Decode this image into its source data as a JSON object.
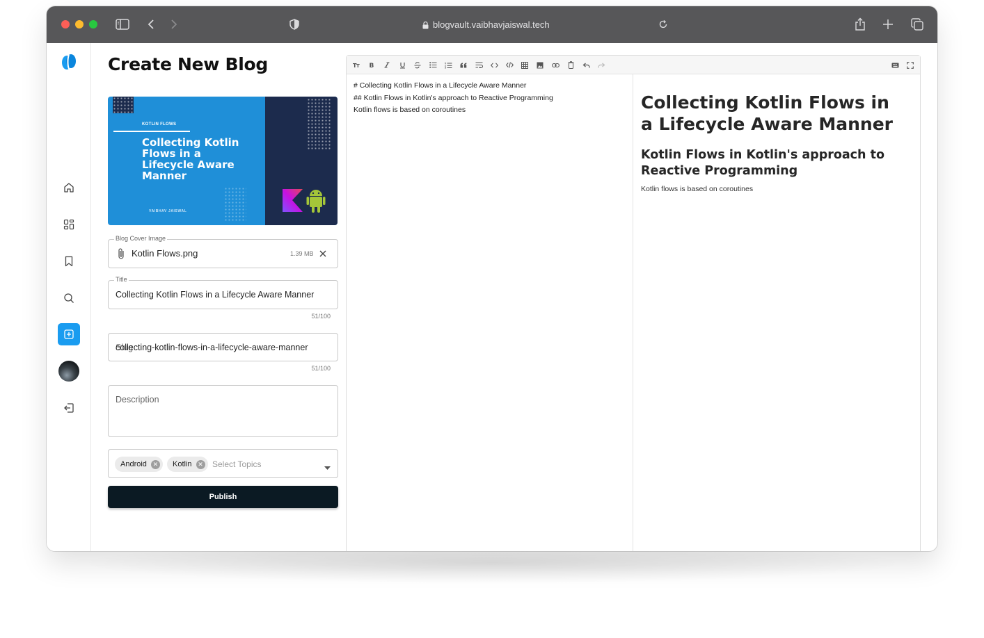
{
  "browser": {
    "url": "blogvault.vaibhavjaiswal.tech"
  },
  "form": {
    "page_title": "Create New Blog",
    "cover_art": {
      "tag": "KOTLIN FLOWS",
      "headline": "Collecting Kotlin Flows in a Lifecycle Aware Manner",
      "author": "VAIBHAV JAISWAL"
    },
    "cover_field": {
      "legend": "Blog Cover Image",
      "filename": "Kotlin Flows.png",
      "size": "1.39 MB"
    },
    "title_field": {
      "legend": "Title",
      "value": "Collecting Kotlin Flows in a Lifecycle Aware Manner",
      "counter": "51/100"
    },
    "slug_field": {
      "label": "Slug",
      "value": "collecting-kotlin-flows-in-a-lifecycle-aware-manner",
      "counter": "51/100"
    },
    "description_field": {
      "placeholder": "Description"
    },
    "topics": {
      "chips": [
        "Android",
        "Kotlin"
      ],
      "placeholder": "Select Topics"
    },
    "publish_label": "Publish"
  },
  "editor": {
    "markdown_lines": [
      "# Collecting Kotlin Flows in a Lifecycle Aware Manner",
      "## Kotlin Flows in Kotlin's approach to Reactive Programming",
      "Kotlin flows is based on coroutines"
    ],
    "preview": {
      "h1": "Collecting Kotlin Flows in a Lifecycle Aware Manner",
      "h2": "Kotlin Flows in Kotlin's approach to Reactive Programming",
      "paragraph": "Kotlin flows is based on coroutines"
    },
    "toolbar": [
      "heading-icon",
      "bold-icon",
      "italic-icon",
      "underline-icon",
      "strikethrough-icon",
      "bullet-list-icon",
      "ordered-list-icon",
      "quote-icon",
      "wrap-icon",
      "inline-code-icon",
      "code-block-icon",
      "table-icon",
      "image-icon",
      "link-icon",
      "clear-icon",
      "undo-icon",
      "redo-icon",
      "keyboard-icon",
      "fullscreen-icon"
    ]
  },
  "colors": {
    "accent": "#1a9cf0",
    "publish_bg": "#0b1a23",
    "titlebar": "#575759"
  }
}
